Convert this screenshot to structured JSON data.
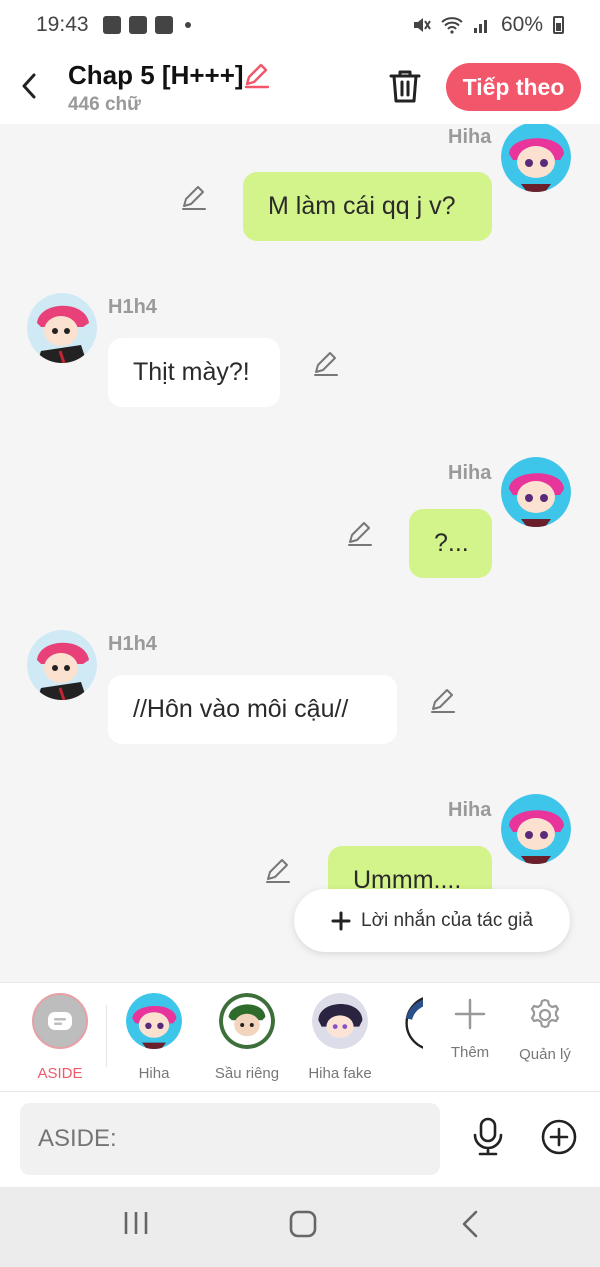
{
  "status_bar": {
    "time": "19:43",
    "battery": "60%"
  },
  "header": {
    "title": "Chap 5 [H+++]",
    "subtitle": "446 chữ",
    "next_label": "Tiếp theo"
  },
  "messages": [
    {
      "name": "Hiha",
      "text": "M làm cái qq j v?",
      "side": "right"
    },
    {
      "name": "H1h4",
      "text": "Thịt mày?!",
      "side": "left"
    },
    {
      "name": "Hiha",
      "text": "?...",
      "side": "right"
    },
    {
      "name": "H1h4",
      "text": "//Hôn vào môi cậu//",
      "side": "left"
    },
    {
      "name": "Hiha",
      "text": "Ummm....",
      "side": "right"
    }
  ],
  "author_note": "Lời nhắn của tác giả",
  "characters": [
    {
      "label": "ASIDE"
    },
    {
      "label": "Hiha"
    },
    {
      "label": "Sầu riêng"
    },
    {
      "label": "Hiha fake"
    }
  ],
  "tools": {
    "add": "Thêm",
    "manage": "Quản lý"
  },
  "input": {
    "placeholder": "ASIDE:"
  },
  "colors": {
    "accent": "#f2566a",
    "my_bubble": "#d3f48a",
    "their_bubble": "#ffffff"
  },
  "icons": [
    "back-arrow-icon",
    "edit-pencil-icon",
    "trash-icon",
    "plus-icon",
    "gear-icon",
    "microphone-icon",
    "add-circle-icon"
  ]
}
